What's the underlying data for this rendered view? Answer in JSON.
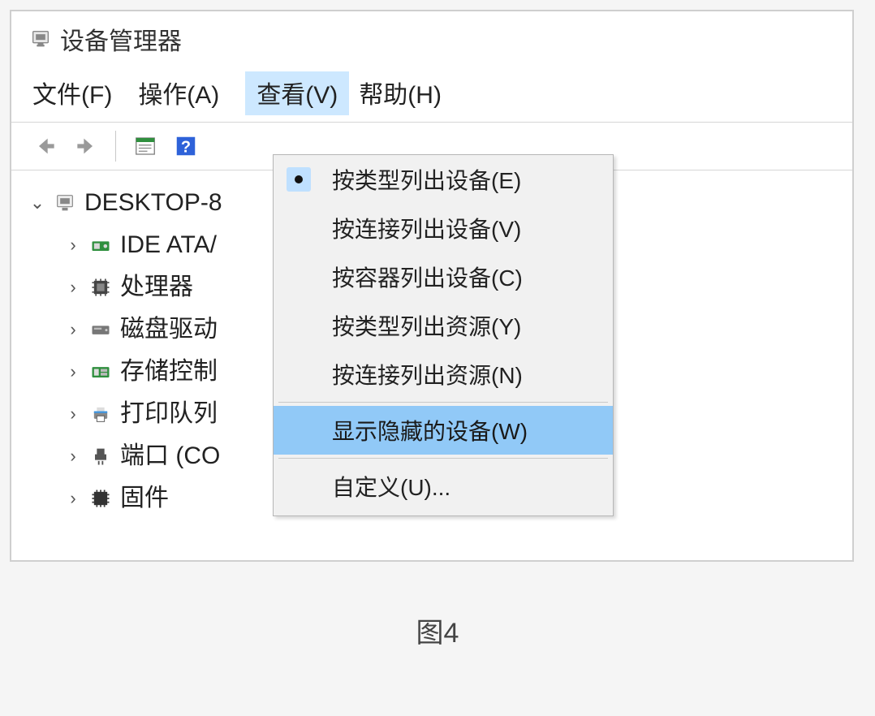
{
  "window": {
    "title": "设备管理器"
  },
  "menubar": {
    "file": "文件(F)",
    "action": "操作(A)",
    "view": "查看(V)",
    "help": "帮助(H)"
  },
  "tree": {
    "root": "DESKTOP-8",
    "children": [
      "IDE ATA/",
      "处理器",
      "磁盘驱动",
      "存储控制",
      "打印队列",
      "端口 (CO",
      "固件"
    ]
  },
  "view_menu": {
    "devices_by_type": "按类型列出设备(E)",
    "devices_by_connection": "按连接列出设备(V)",
    "devices_by_container": "按容器列出设备(C)",
    "resources_by_type": "按类型列出资源(Y)",
    "resources_by_connection": "按连接列出资源(N)",
    "show_hidden": "显示隐藏的设备(W)",
    "customize": "自定义(U)..."
  },
  "caption": "图4"
}
